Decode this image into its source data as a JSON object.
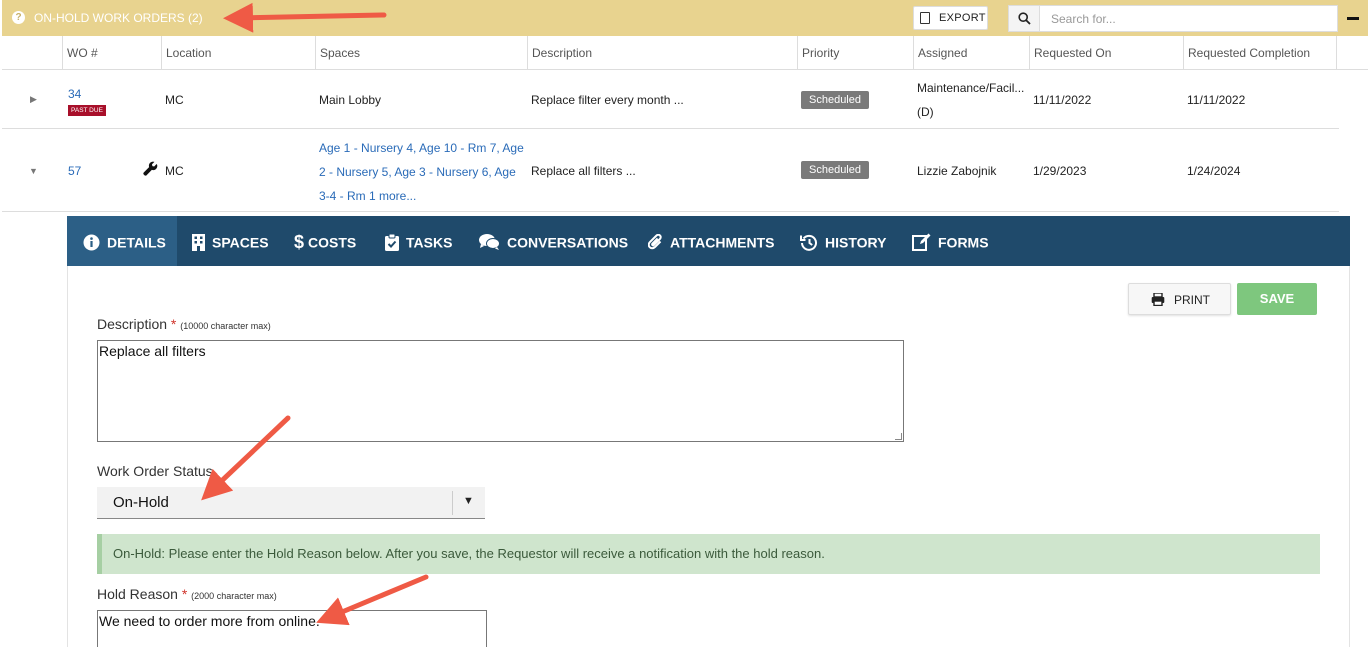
{
  "header": {
    "title": "ON-HOLD WORK ORDERS (2)",
    "export_label": "EXPORT",
    "search_placeholder": "Search for..."
  },
  "columns": [
    "WO #",
    "Location",
    "Spaces",
    "Description",
    "Priority",
    "Assigned",
    "Requested On",
    "Requested Completion"
  ],
  "rows": [
    {
      "wo": "34",
      "badge": "PAST DUE",
      "location": "MC",
      "spaces": "Main Lobby",
      "description": "Replace filter every month ...",
      "priority": "Scheduled",
      "assigned_line1": "Maintenance/Facil...",
      "assigned_line2": "(D)",
      "requested_on": "11/11/2022",
      "requested_completion": "11/11/2022"
    },
    {
      "wo": "57",
      "location": "MC",
      "spaces": "Age 1 - Nursery 4, Age 10 - Rm 7, Age 2 - Nursery 5, Age 3 - Nursery 6, Age 3-4 - Rm 1 more...",
      "description": "Replace all filters ...",
      "priority": "Scheduled",
      "assigned": "Lizzie Zabojnik",
      "requested_on": "1/29/2023",
      "requested_completion": "1/24/2024"
    }
  ],
  "tabs": [
    {
      "label": "DETAILS",
      "icon": "info-icon"
    },
    {
      "label": "SPACES",
      "icon": "building-icon"
    },
    {
      "label": "COSTS",
      "icon": "dollar-icon"
    },
    {
      "label": "TASKS",
      "icon": "clipboard-check-icon"
    },
    {
      "label": "CONVERSATIONS",
      "icon": "chat-bubbles-icon"
    },
    {
      "label": "ATTACHMENTS",
      "icon": "paperclip-icon"
    },
    {
      "label": "HISTORY",
      "icon": "history-icon"
    },
    {
      "label": "FORMS",
      "icon": "edit-form-icon"
    }
  ],
  "details": {
    "print_label": "PRINT",
    "save_label": "SAVE",
    "description_label": "Description",
    "description_hint": "(10000 character max)",
    "description_value": "Replace all filters",
    "status_label": "Work Order Status",
    "status_value": "On-Hold",
    "notice_prefix": "On-Hold",
    "notice_text": ": Please enter the Hold Reason below. After you save, the Requestor will receive a notification with the hold reason.",
    "hold_reason_label": "Hold Reason",
    "hold_reason_hint": "(2000 character max)",
    "hold_reason_value": "We need to order more from online."
  },
  "colors": {
    "header_bg": "#e8d38f",
    "tabbar_bg": "#1f4a6b",
    "save_bg": "#7ec77e",
    "past_due": "#a80f2a",
    "annotation_arrow": "#ef5a45"
  }
}
